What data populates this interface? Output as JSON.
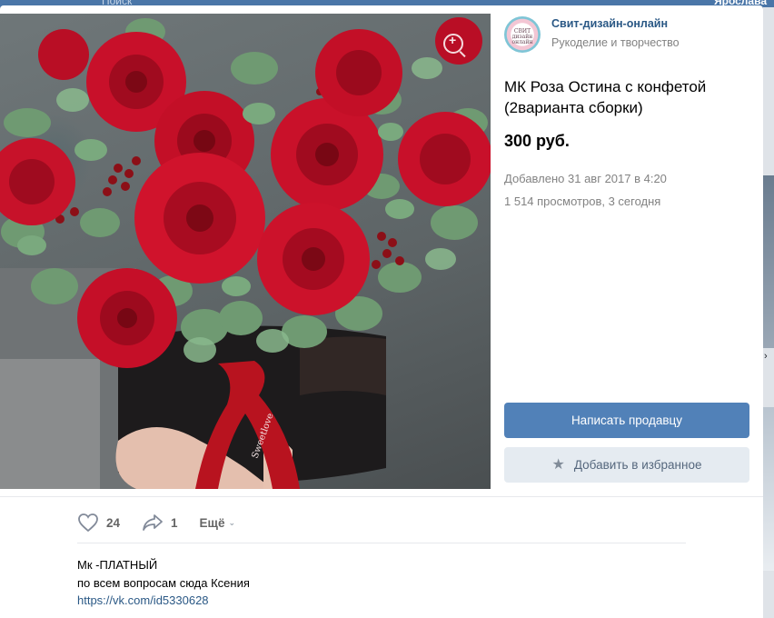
{
  "background": {
    "search_label": "Поиск",
    "user_name": "Ярослава"
  },
  "seller": {
    "avatar_text": "СВИТ дизайн онлайн",
    "name": "Свит-дизайн-онлайн",
    "category": "Рукоделие и творчество"
  },
  "item": {
    "title": "МК Роза Остина с конфетой (2варианта сборки)",
    "price": "300 руб.",
    "added": "Добавлено 31 авг 2017 в 4:20",
    "views": "1 514 просмотров, 3 сегодня",
    "photo_ribbon_text": "Sweetlove"
  },
  "buttons": {
    "contact_seller": "Написать продавцу",
    "add_favorite": "Добавить в избранное"
  },
  "actions": {
    "likes": "24",
    "shares": "1",
    "more": "Ещё"
  },
  "description": {
    "line1": "Мк -ПЛАТНЫЙ",
    "line2": "по всем вопросам сюда Ксения",
    "link": "https://vk.com/id5330628"
  },
  "colors": {
    "link": "#2a5885",
    "primary_button": "#5181b8",
    "secondary_button": "#e5ebf1",
    "header": "#4a76a8"
  },
  "icons": {
    "zoom": "zoom-in-icon",
    "star": "star-icon",
    "like": "heart-icon",
    "share": "share-arrow-icon",
    "more": "chevron-down-icon"
  }
}
